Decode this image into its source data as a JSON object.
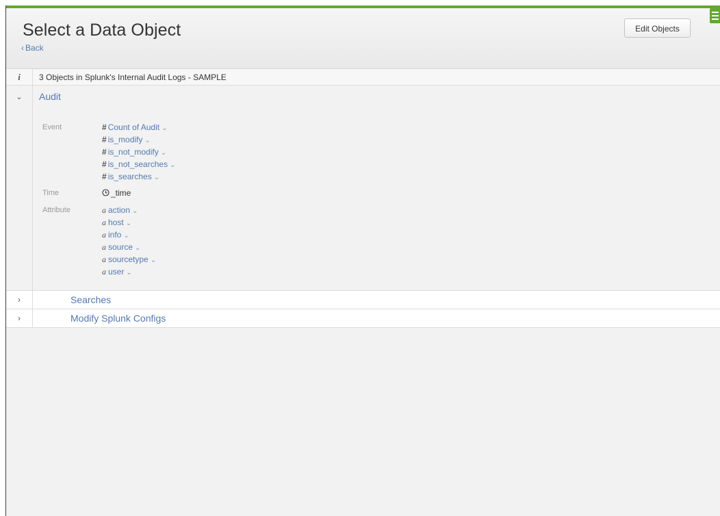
{
  "header": {
    "title": "Select a Data Object",
    "back_label": "Back",
    "edit_button_label": "Edit Objects"
  },
  "info": {
    "text": "3 Objects in Splunk's Internal Audit Logs - SAMPLE"
  },
  "objects": {
    "audit": {
      "title": "Audit",
      "event_label": "Event",
      "event_fields": [
        "Count of Audit",
        "is_modify",
        "is_not_modify",
        "is_not_searches",
        "is_searches"
      ],
      "time_label": "Time",
      "time_field": "_time",
      "attribute_label": "Attribute",
      "attribute_fields": [
        "action",
        "host",
        "info",
        "source",
        "sourcetype",
        "user"
      ]
    },
    "searches": {
      "title": "Searches"
    },
    "modify": {
      "title": "Modify Splunk Configs"
    }
  },
  "icons": {
    "info": "info-icon",
    "expanded": "chevron-down-icon",
    "collapsed": "chevron-right-icon",
    "number_prefix": "#",
    "string_prefix": "a",
    "clock": "clock-icon",
    "menu": "hamburger-menu-icon"
  },
  "colors": {
    "accent": "#65a637",
    "link": "#5379af"
  }
}
